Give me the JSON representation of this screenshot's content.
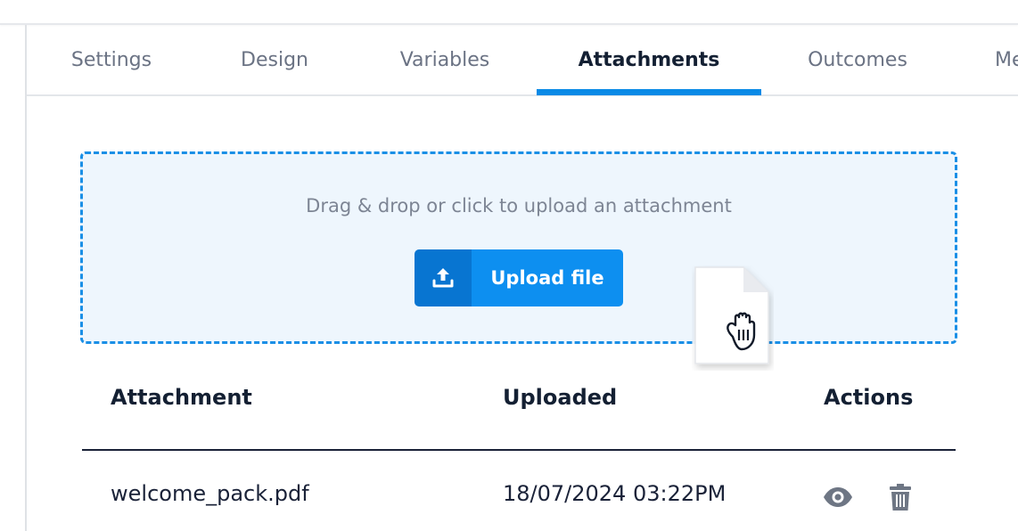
{
  "tabs": [
    {
      "label": "Settings"
    },
    {
      "label": "Design"
    },
    {
      "label": "Variables"
    },
    {
      "label": "Attachments",
      "active": true
    },
    {
      "label": "Outcomes"
    },
    {
      "label": "Me"
    }
  ],
  "dropzone": {
    "prompt": "Drag & drop or click to upload an attachment",
    "upload_label": "Upload file",
    "upload_icon": "upload-icon"
  },
  "table": {
    "headers": {
      "attachment": "Attachment",
      "uploaded": "Uploaded",
      "actions": "Actions"
    },
    "rows": [
      {
        "name": "welcome_pack.pdf",
        "uploaded": "18/07/2024 03:22PM",
        "actions": [
          "eye-icon",
          "trash-icon"
        ]
      }
    ]
  },
  "drag_cursor": {
    "icon": "grab-hand-icon",
    "file_icon": "file-icon"
  },
  "colors": {
    "accent": "#0d8ff0",
    "accent_dark": "#0875d1",
    "dropzone_bg": "#eef6fd",
    "icon_grey": "#6e7684"
  }
}
